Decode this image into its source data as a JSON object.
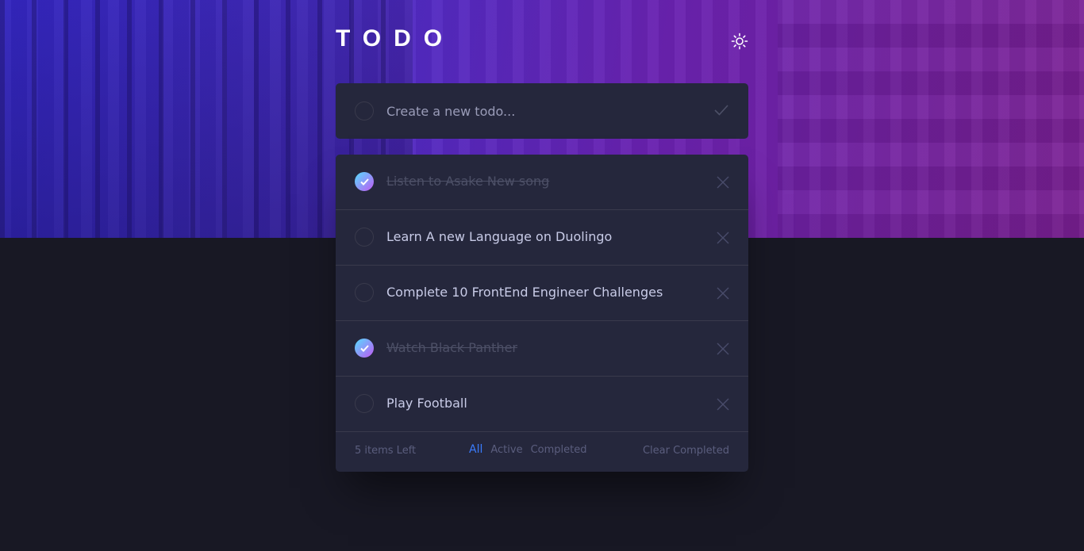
{
  "app": {
    "title": "TODO"
  },
  "create": {
    "placeholder": "Create a new todo..."
  },
  "todos": [
    {
      "text": "Listen to Asake New song",
      "completed": true
    },
    {
      "text": "Learn A new Language on Duolingo",
      "completed": false
    },
    {
      "text": "Complete 10 FrontEnd Engineer Challenges",
      "completed": false
    },
    {
      "text": "Watch Black Panther",
      "completed": true
    },
    {
      "text": "Play Football",
      "completed": false
    }
  ],
  "footer": {
    "items_left": "5 items Left",
    "filters": [
      "All",
      "Active",
      "Completed"
    ],
    "active_filter": "All",
    "clear_label": "Clear Completed"
  },
  "icons": {
    "theme_toggle": "sun-icon",
    "submit": "check-icon",
    "delete": "cross-icon",
    "complete": "check-icon"
  },
  "colors": {
    "accent": "#3a7cfd",
    "check_gradient_start": "#55ddff",
    "check_gradient_end": "#c058f3",
    "card_bg": "#25273c",
    "page_bg": "#181824"
  }
}
